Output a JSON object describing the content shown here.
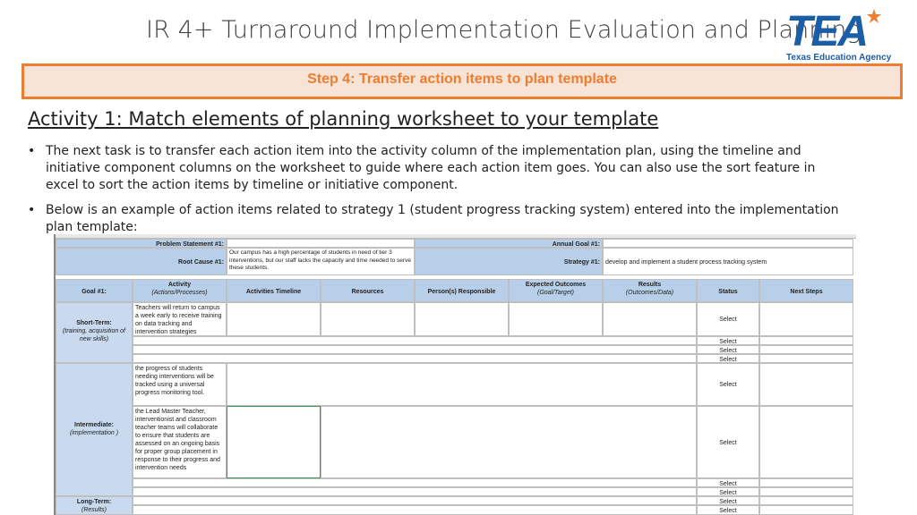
{
  "header": {
    "title": "IR 4+ Turnaround Implementation Evaluation and  Planning",
    "logo_text": "TEA",
    "logo_subtext": "Texas Education Agency",
    "colors": {
      "accent": "#ed7d31",
      "step_bg": "#f8e4d6",
      "logo_blue": "#1a5ea8",
      "header_cell_blue": "#b7cfe9"
    }
  },
  "step": {
    "label": "Step 4: Transfer action items to plan template"
  },
  "activity": {
    "title": "Activity 1: Match elements of planning worksheet to your template"
  },
  "bullets": [
    {
      "symbol": "•",
      "text": "The next task is to transfer each action item into the activity column of the implementation plan, using the timeline and initiative component columns on the worksheet to guide where each action item goes. You can also use the sort feature in excel to sort the action items by timeline or initiative component."
    },
    {
      "symbol": "•",
      "text": "Below is an example of action items related to strategy 1 (student progress tracking system) entered into the implementation plan template:"
    }
  ],
  "sheet": {
    "problem_statement_label": "Problem Statement #1:",
    "root_cause_label": "Root Cause #1:",
    "root_cause_text": "Our campus has a high percentage of students in need of tier 3 interventions, but our staff lacks the capacity and time needed to serve these students.",
    "annual_goal_label": "Annual Goal #1:",
    "strategy_label": "Strategy #1:",
    "strategy_text": "develop and implement a student process tracking system",
    "columns": {
      "goal": "Goal #1:",
      "activity": "Activity",
      "activity_sub": "(Actions/Processes)",
      "timeline": "Activities Timeline",
      "resources": "Resources",
      "persons": "Person(s) Responsible",
      "expected": "Expected Outcomes",
      "expected_sub": "(Goal/Target)",
      "results": "Results",
      "results_sub": "(Outcomes/Data)",
      "status": "Status",
      "next": "Next Steps"
    },
    "sections": {
      "short_term": "Short-Term:",
      "short_term_sub": "(training, acquisition of new skills)",
      "intermediate": "Intermediate:",
      "intermediate_sub": "(implementation )",
      "long_term": "Long-Term:",
      "long_term_sub": "(Results)"
    },
    "activities": {
      "a1": "Teachers will return to campus a week early to receive training on data tracking and intervention strategies",
      "a2": "the progress of students needing interventions will be tracked using a universal progress monitoring tool.",
      "a3": "the Lead Master Teacher, interventionist and classroom teacher teams will collaborate to ensure that students are assessed on an ongoing basis for proper group placement in response to their progress and intervention needs"
    },
    "select_label": "Select"
  }
}
